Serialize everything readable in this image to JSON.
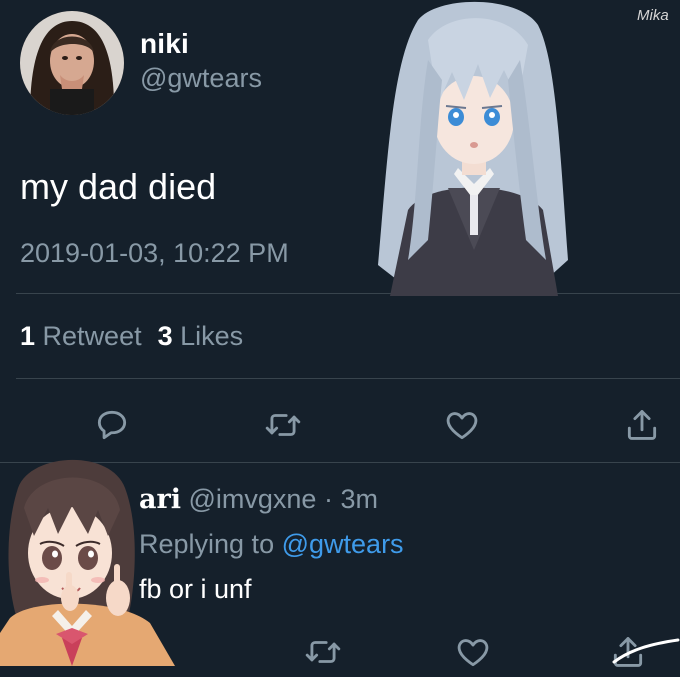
{
  "watermark": "Mika",
  "tweet": {
    "display_name": "niki",
    "handle": "@gwtears",
    "text": "my dad died",
    "timestamp": "2019-01-03, 10:22 PM",
    "retweet_count": "1",
    "retweet_label": "Retweet",
    "like_count": "3",
    "like_label": "Likes",
    "actions": [
      "reply-icon",
      "retweet-icon",
      "heart-icon",
      "share-icon"
    ]
  },
  "reply": {
    "display_name": "ari",
    "handle_time": "@imvgxne · 3m",
    "replying_prefix": "Replying to",
    "replying_to": "@gwtears",
    "text": "fb or i unf",
    "actions": [
      "retweet-icon",
      "heart-icon",
      "share-icon"
    ]
  },
  "colors": {
    "background": "#15202b",
    "secondary_text": "#8899a6",
    "link": "#3f9bea",
    "divider": "#38444d"
  }
}
